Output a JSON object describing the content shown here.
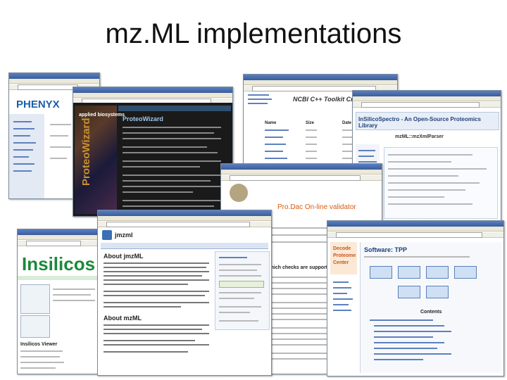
{
  "slide_title": "mz.ML implementations",
  "phenyx": {
    "logo": "PHENYX"
  },
  "proteowizard": {
    "header": "applied biosystems",
    "side_text": "ProteoWizard",
    "box_title": "ProteoWizard"
  },
  "ncbi": {
    "heading": "NCBI C++ Toolkit Cross Reference",
    "cols": [
      "Name",
      "Size",
      "Date (GMT)"
    ]
  },
  "insilicospectro": {
    "heading": "InSilicoSpectro - An Open-Source Proteomics Library",
    "class_name": "mzML::mzXmlParser"
  },
  "prodac": {
    "heading": "Pro.Dac On-line validator",
    "checks_text": "Which checks are supported mzML format",
    "logo_lines": [
      "Decode",
      "Proteome",
      "Center"
    ]
  },
  "tpp": {
    "heading": "Software: TPP",
    "contents": "Contents"
  },
  "insilicos": {
    "logo": "Insilicos",
    "viewer": "Insilicos Viewer"
  },
  "jmzml": {
    "name": "jmzml",
    "about": "About jmzML",
    "also": "About mzML"
  }
}
